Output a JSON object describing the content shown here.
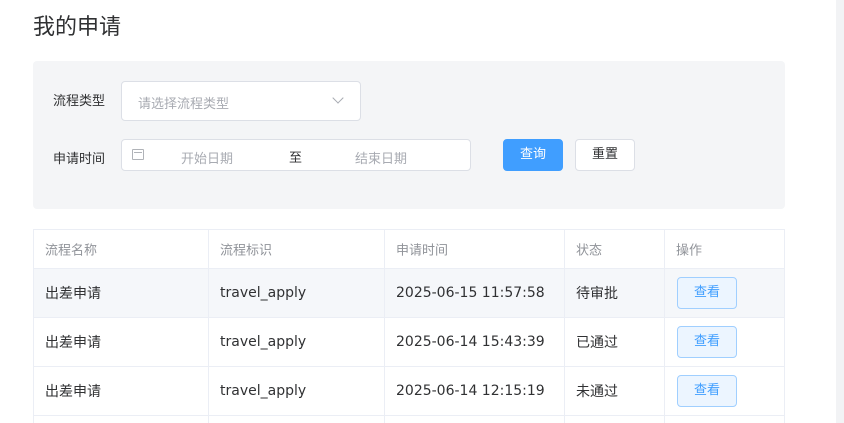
{
  "page": {
    "title": "我的申请"
  },
  "filters": {
    "process_type_label": "流程类型",
    "process_type_placeholder": "请选择流程类型",
    "date_label": "申请时间",
    "date_start_placeholder": "开始日期",
    "date_separator": "至",
    "date_end_placeholder": "结束日期",
    "query_button": "查询",
    "reset_button": "重置"
  },
  "table": {
    "headers": [
      "流程名称",
      "流程标识",
      "申请时间",
      "状态",
      "操作"
    ],
    "rows": [
      {
        "name": "出差申请",
        "key": "travel_apply",
        "time": "2025-06-15 11:57:58",
        "status": "待审批",
        "action": "查看"
      },
      {
        "name": "出差申请",
        "key": "travel_apply",
        "time": "2025-06-14 15:43:39",
        "status": "已通过",
        "action": "查看"
      },
      {
        "name": "出差申请",
        "key": "travel_apply",
        "time": "2025-06-14 12:15:19",
        "status": "未通过",
        "action": "查看"
      }
    ]
  },
  "colors": {
    "primary": "#409eff",
    "panel_bg": "#f4f5f7",
    "border": "#ebeef5"
  }
}
